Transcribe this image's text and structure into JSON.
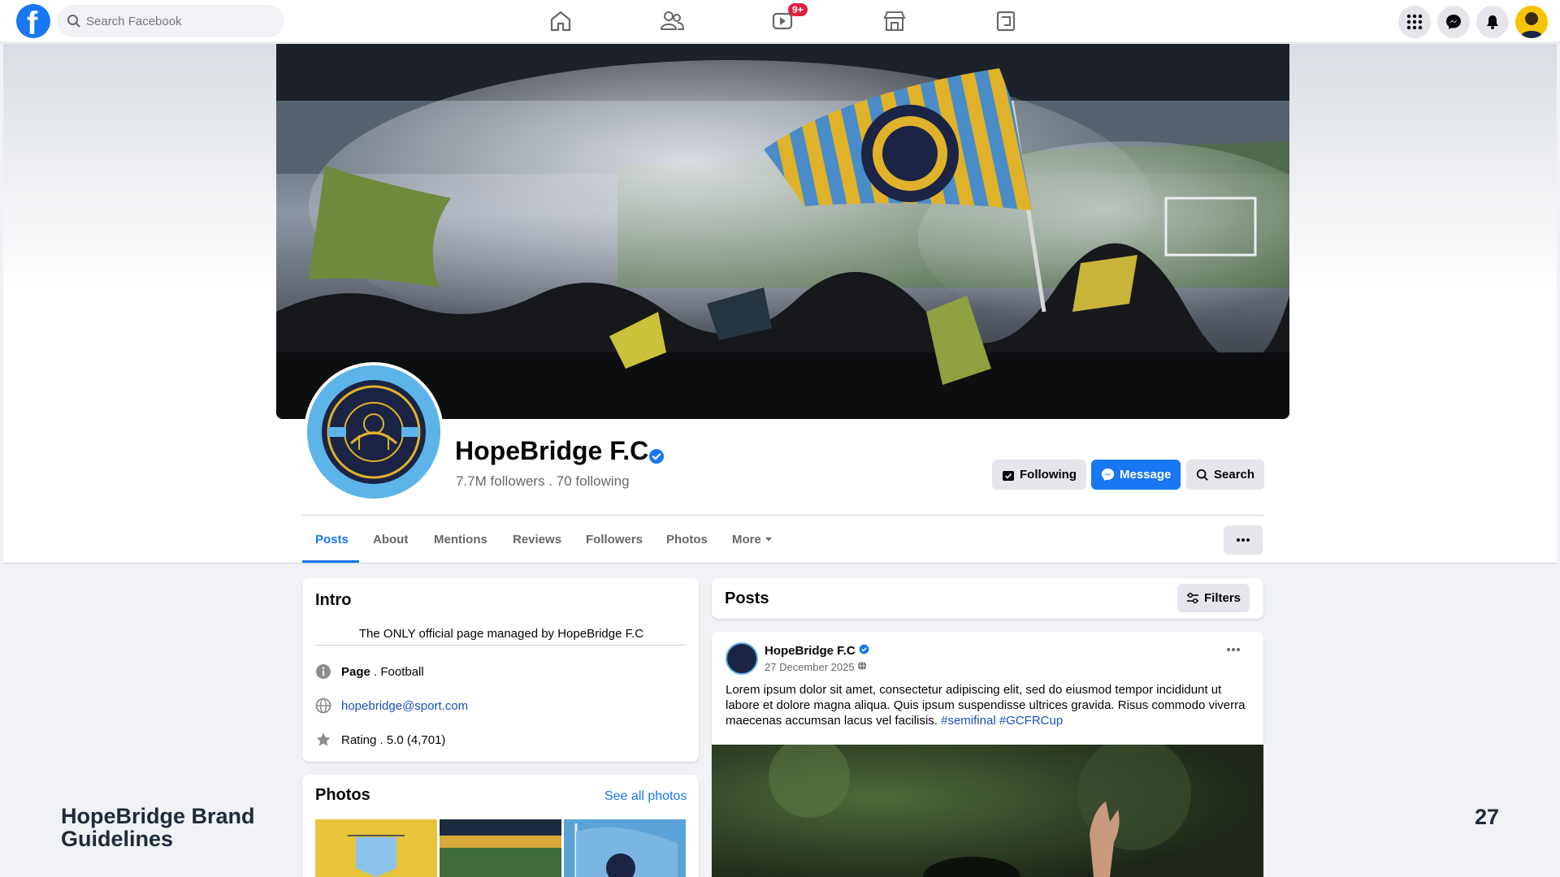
{
  "topnav": {
    "logo_letter": "f",
    "search_placeholder": "Search Facebook",
    "video_badge": "9+"
  },
  "page": {
    "name": "HopeBridge F.C",
    "stats": "7.7M followers . 70 following",
    "buttons": {
      "following": "Following",
      "message": "Message",
      "search": "Search"
    }
  },
  "tabs": [
    "Posts",
    "About",
    "Mentions",
    "Reviews",
    "Followers",
    "Photos",
    "More"
  ],
  "intro": {
    "title": "Intro",
    "description": "The ONLY official page managed by HopeBridge F.C",
    "page_label": "Page",
    "page_category": " . Football",
    "email": "hopebridge@sport.com",
    "rating": "Rating . 5.0 (4,701)"
  },
  "photos": {
    "title": "Photos",
    "see_all": "See all photos"
  },
  "posts": {
    "title": "Posts",
    "filters": "Filters",
    "post": {
      "author": "HopeBridge F.C",
      "date": "27 December 2025",
      "text": "Lorem ipsum dolor sit amet, consectetur adipiscing elit, sed do eiusmod tempor incididunt ut labore et dolore magna aliqua. Quis ipsum suspendisse ultrices gravida. Risus commodo viverra maecenas accumsan lacus vel facilisis.",
      "hashtags": "#semifinal #GCFRCup"
    }
  },
  "footer": {
    "brand_line1": "HopeBridge Brand",
    "brand_line2": "Guidelines",
    "page_number": "27"
  },
  "colors": {
    "facebook_blue": "#1877f2",
    "badge_red": "#e41e3f",
    "club_yellow": "#f5c400",
    "club_sky": "#5db4e8",
    "club_navy": "#1b2444"
  }
}
